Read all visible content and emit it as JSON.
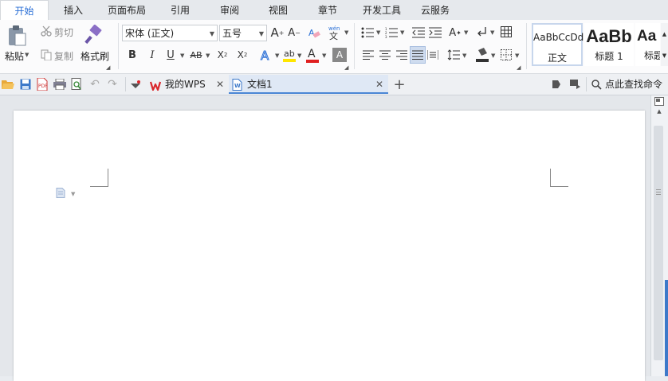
{
  "menu": {
    "tabs": [
      "开始",
      "插入",
      "页面布局",
      "引用",
      "审阅",
      "视图",
      "章节",
      "开发工具",
      "云服务"
    ]
  },
  "clipboard": {
    "paste_label": "粘贴",
    "cut_label": "剪切",
    "copy_label": "复制",
    "format_painter_label": "格式刷"
  },
  "font": {
    "name": "宋体 (正文)",
    "size": "五号"
  },
  "styles": {
    "items": [
      {
        "preview": "AaBbCcDd",
        "label": "正文"
      },
      {
        "preview": "AaBb",
        "label": "标题 1"
      },
      {
        "preview": "Aa",
        "label": "标题"
      }
    ]
  },
  "qabar": {
    "tabs": [
      "我的WPS",
      "文档1"
    ],
    "find_label": "点此查找命令"
  },
  "colors": {
    "accent": "#2a6fd6",
    "wps_red": "#d9262b",
    "highlight_yellow": "#ffe600",
    "font_red": "#e02020"
  }
}
